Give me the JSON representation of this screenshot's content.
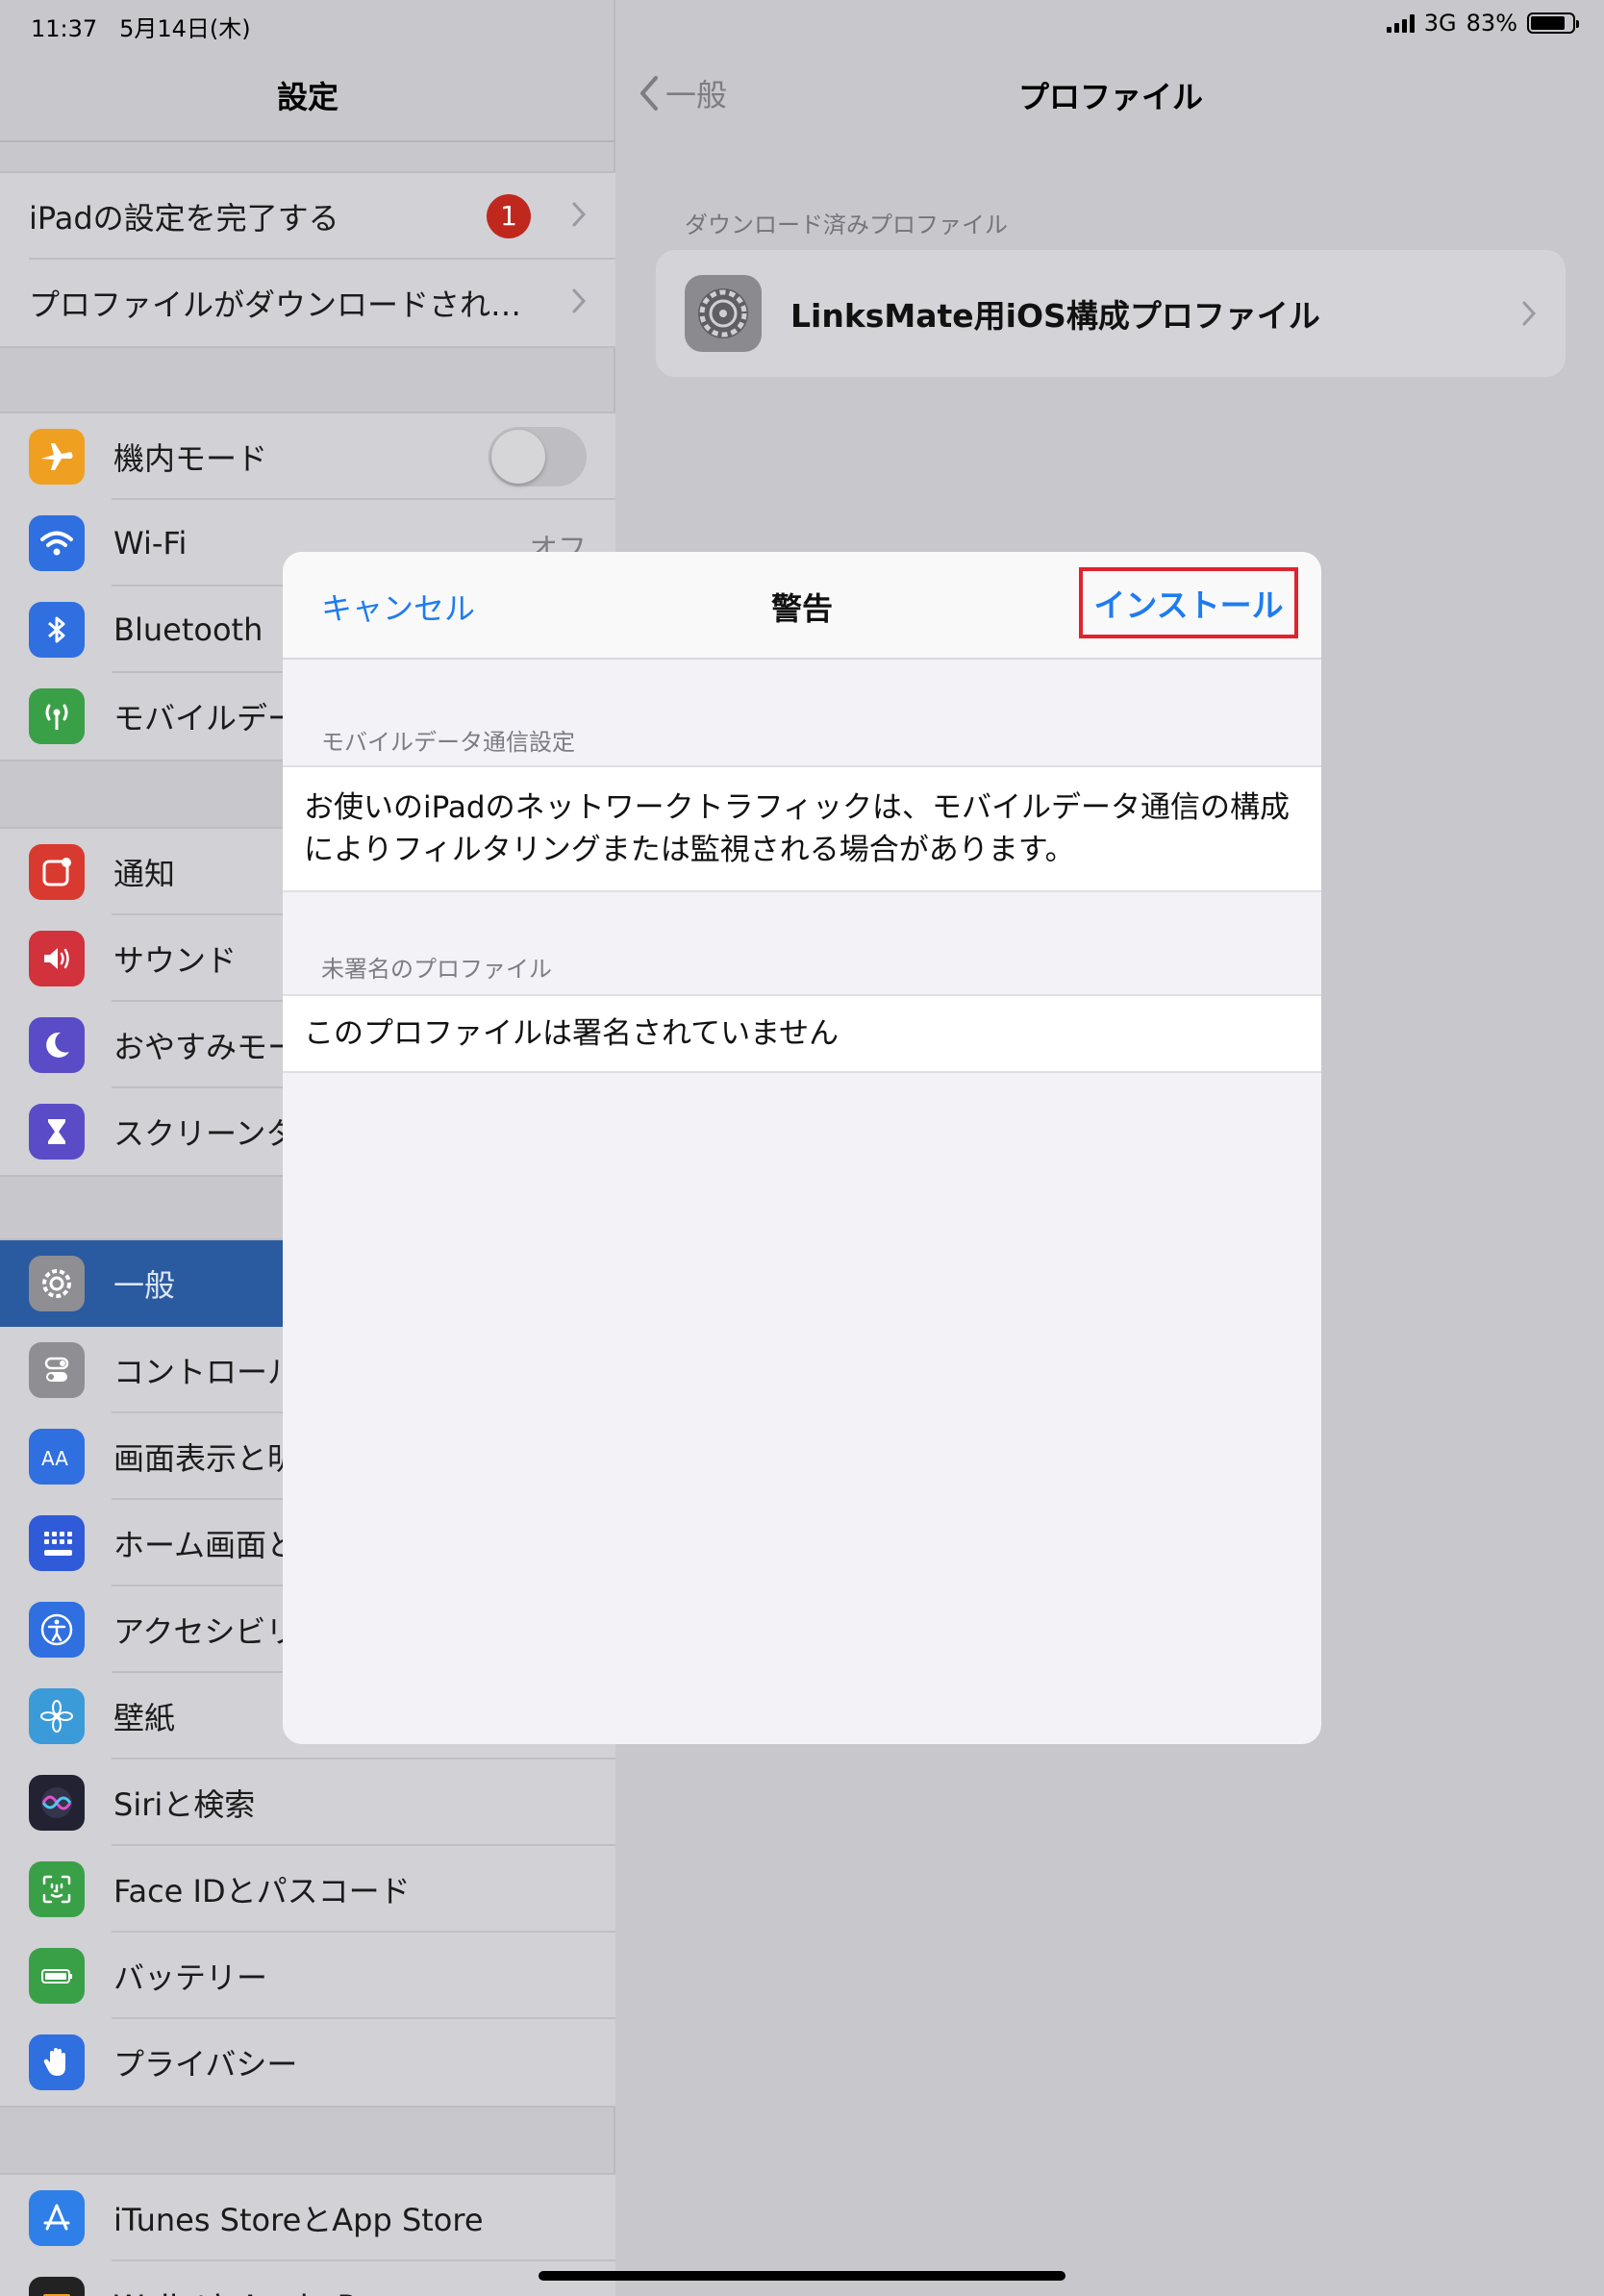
{
  "status_bar": {
    "time": "11:37",
    "date": "5月14日(木)",
    "network": "3G",
    "battery": "83%",
    "battery_level": 0.83
  },
  "sidebar": {
    "title": "設定",
    "top_items": [
      {
        "label": "iPadの設定を完了する",
        "badge": "1"
      },
      {
        "label": "プロファイルがダウンロードされ…"
      }
    ],
    "connectivity": [
      {
        "label": "機内モード",
        "icon": "airplane-icon",
        "color": "#f0a020",
        "toggle": false
      },
      {
        "label": "Wi-Fi",
        "icon": "wifi-icon",
        "color": "#2f6fe0",
        "value": "オフ"
      },
      {
        "label": "Bluetooth",
        "icon": "bluetooth-icon",
        "color": "#2f6fe0"
      },
      {
        "label": "モバイルデータ通信",
        "icon": "antenna-icon",
        "color": "#3aa048"
      }
    ],
    "notifications": [
      {
        "label": "通知",
        "icon": "notification-icon",
        "color": "#d93a30"
      },
      {
        "label": "サウンド",
        "icon": "speaker-icon",
        "color": "#d1323c"
      },
      {
        "label": "おやすみモード",
        "icon": "moon-icon",
        "color": "#5a4cc6"
      },
      {
        "label": "スクリーンタイム",
        "icon": "hourglass-icon",
        "color": "#5a4cc6"
      }
    ],
    "general": [
      {
        "label": "一般",
        "icon": "gear-icon",
        "color": "#8e8e93",
        "selected": true
      },
      {
        "label": "コントロールセンター",
        "icon": "switches-icon",
        "color": "#8e8e93"
      },
      {
        "label": "画面表示と明るさ",
        "icon": "text-size-icon",
        "color": "#2f6fe0"
      },
      {
        "label": "ホーム画面とDock",
        "icon": "home-grid-icon",
        "color": "#2f5ad8"
      },
      {
        "label": "アクセシビリティ",
        "icon": "accessibility-icon",
        "color": "#2f6fe0"
      },
      {
        "label": "壁紙",
        "icon": "flower-icon",
        "color": "#3b9bd8"
      },
      {
        "label": "Siriと検索",
        "icon": "siri-icon",
        "color": "#222233"
      },
      {
        "label": "Face IDとパスコード",
        "icon": "face-id-icon",
        "color": "#3aa048"
      },
      {
        "label": "バッテリー",
        "icon": "battery-icon",
        "color": "#3aa048"
      },
      {
        "label": "プライバシー",
        "icon": "hand-icon",
        "color": "#2f6fe0"
      }
    ],
    "store": [
      {
        "label": "iTunes StoreとApp Store",
        "icon": "app-store-icon",
        "color": "#2f7fe8"
      },
      {
        "label": "WalletとApple Pay",
        "icon": "wallet-icon",
        "color": "#222222"
      }
    ]
  },
  "detail": {
    "back_label": "一般",
    "title": "プロファイル",
    "section_label": "ダウンロード済みプロファイル",
    "profile_name": "LinksMate用iOS構成プロファイル"
  },
  "modal": {
    "cancel": "キャンセル",
    "title": "警告",
    "install": "インストール",
    "sections": [
      {
        "header": "モバイルデータ通信設定",
        "body": "お使いのiPadのネットワークトラフィックは、モバイルデータ通信の構成によりフィルタリングまたは監視される場合があります。"
      },
      {
        "header": "未署名のプロファイル",
        "body": "このプロファイルは署名されていません"
      }
    ]
  },
  "colors": {
    "accent": "#1e7cf0",
    "highlight_border": "#e0232e",
    "badge": "#c0281e"
  }
}
